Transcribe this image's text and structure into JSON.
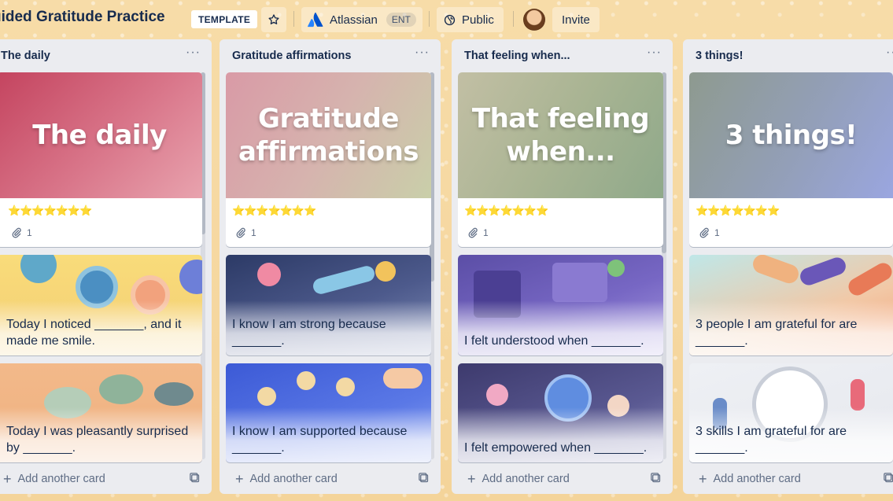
{
  "header": {
    "board_title": "uided Gratitude Practice",
    "template_badge": "TEMPLATE",
    "workspace_name": "Atlassian",
    "workspace_badge": "ENT",
    "visibility": "Public",
    "invite_label": "Invite"
  },
  "lists": [
    {
      "title": "The daily",
      "menu": "···",
      "cover_text": "The daily",
      "stars": "⭐⭐⭐⭐⭐⭐⭐",
      "attachments": "1",
      "cards": [
        "Today I noticed _______, and it made me smile.",
        "Today I was pleasantly surprised by _______."
      ],
      "add_card": "Add another card"
    },
    {
      "title": "Gratitude affirmations",
      "menu": "···",
      "cover_text": "Gratitude affirmations",
      "stars": "⭐⭐⭐⭐⭐⭐⭐",
      "attachments": "1",
      "cards": [
        "I know I am strong because _______.",
        "I know I am supported because _______."
      ],
      "add_card": "Add another card"
    },
    {
      "title": "That feeling when...",
      "menu": "···",
      "cover_text": "That feeling when...",
      "stars": "⭐⭐⭐⭐⭐⭐⭐",
      "attachments": "1",
      "cards": [
        "I felt understood when _______.",
        "I felt empowered when _______."
      ],
      "add_card": "Add another card"
    },
    {
      "title": "3 things!",
      "menu": "···",
      "cover_text": "3 things!",
      "stars": "⭐⭐⭐⭐⭐⭐⭐",
      "attachments": "1",
      "cards": [
        "3 people I am grateful for are _______.",
        "3 skills I am grateful for are _______."
      ],
      "add_card": "Add another card"
    }
  ],
  "colors": {
    "board_background": "#f6d9a3",
    "list_background": "#ebecf0",
    "text_primary": "#172b4d",
    "text_subtle": "#5e6c84",
    "atlassian_blue": "#0052cc"
  }
}
